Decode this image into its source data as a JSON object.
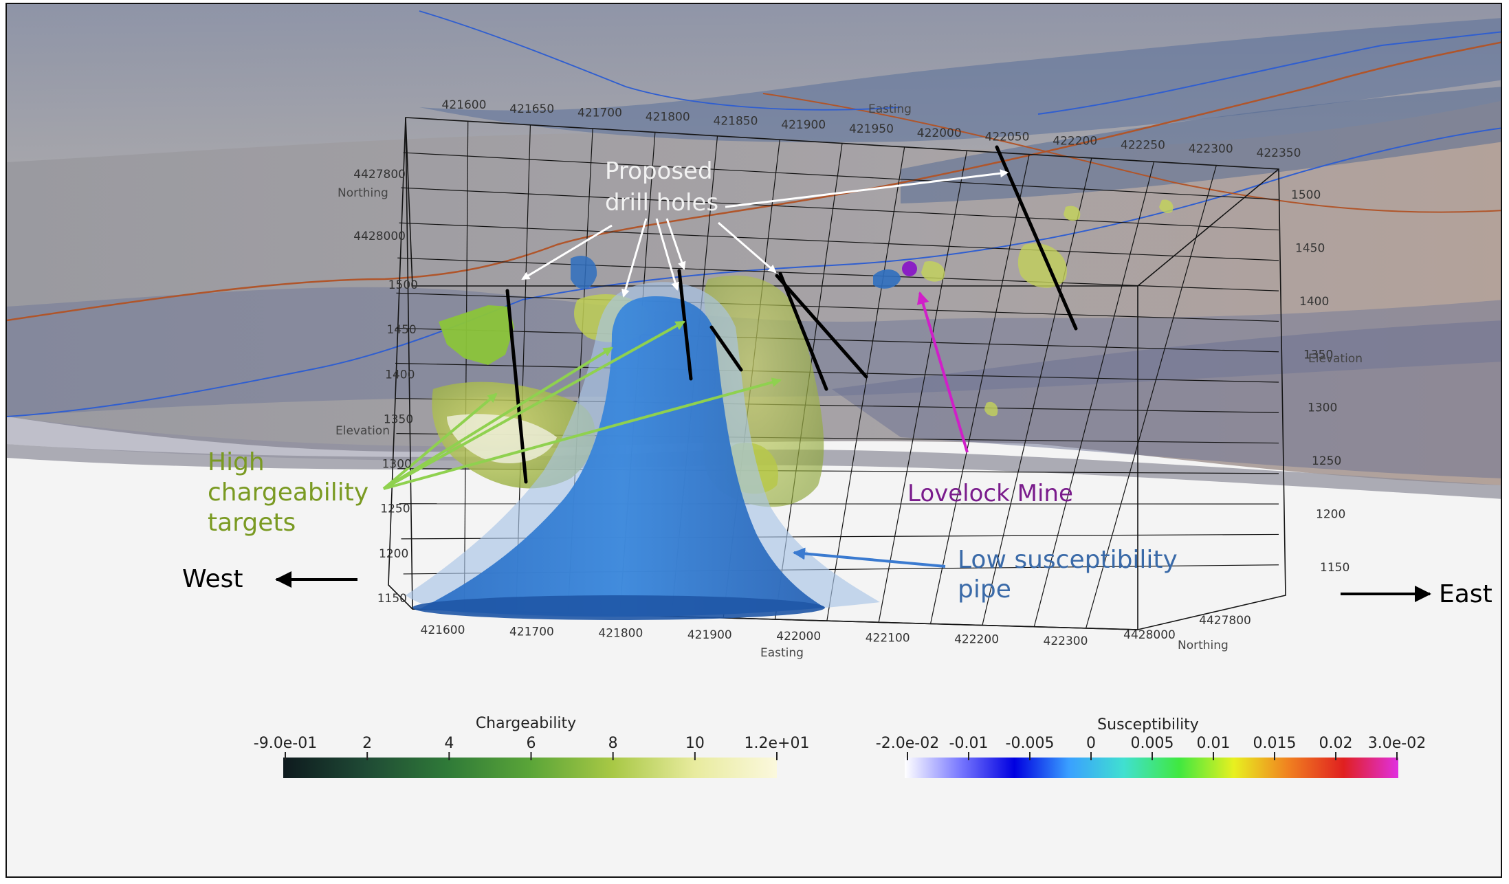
{
  "annotations": {
    "drill_line1": "Proposed",
    "drill_line2": "drill holes",
    "charge_line1": "High",
    "charge_line2": "chargeability",
    "charge_line3": "targets",
    "mine": "Lovelock Mine",
    "pipe_line1": "Low susceptibility",
    "pipe_line2": "pipe",
    "west": "West",
    "east": "East"
  },
  "axes": {
    "easting_label": "Easting",
    "northing_label": "Northing",
    "elevation_label": "Elevation",
    "top_easting_ticks": [
      "421600",
      "421650",
      "421700",
      "421800",
      "421850",
      "421900",
      "421950",
      "422000",
      "422050",
      "422200",
      "422250",
      "422300",
      "422350"
    ],
    "bottom_easting_ticks": [
      "421600",
      "421700",
      "421800",
      "421900",
      "422000",
      "422100",
      "422200",
      "422300"
    ],
    "left_elevation_ticks": [
      "1500",
      "1450",
      "1400",
      "1350",
      "1300",
      "1250",
      "1200",
      "1150"
    ],
    "right_elevation_ticks": [
      "1500",
      "1450",
      "1400",
      "1350",
      "1300",
      "1250",
      "1200",
      "1150"
    ],
    "left_northing_ticks": [
      "4427800",
      "4428000"
    ],
    "right_northing_ticks": [
      "4428000",
      "4427800"
    ]
  },
  "colorbars": {
    "chargeability": {
      "title": "Chargeability",
      "ticks": [
        "-9.0e-01",
        "2",
        "4",
        "6",
        "8",
        "10",
        "1.2e+01"
      ],
      "colors": [
        "#0e1a1e",
        "#1f4a35",
        "#2f7a38",
        "#5aa538",
        "#a8c845",
        "#e8eb9e",
        "#fbf8dd"
      ]
    },
    "susceptibility": {
      "title": "Susceptibility",
      "ticks": [
        "-2.0e-02",
        "-0.01",
        "-0.005",
        "0",
        "0.005",
        "0.01",
        "0.015",
        "0.02",
        "3.0e-02"
      ],
      "colors": [
        "#ffffff",
        "#7a7aff",
        "#0000e0",
        "#3aa0ff",
        "#40e0d0",
        "#40e840",
        "#e8f020",
        "#f08020",
        "#e02020",
        "#e030e0"
      ]
    }
  }
}
